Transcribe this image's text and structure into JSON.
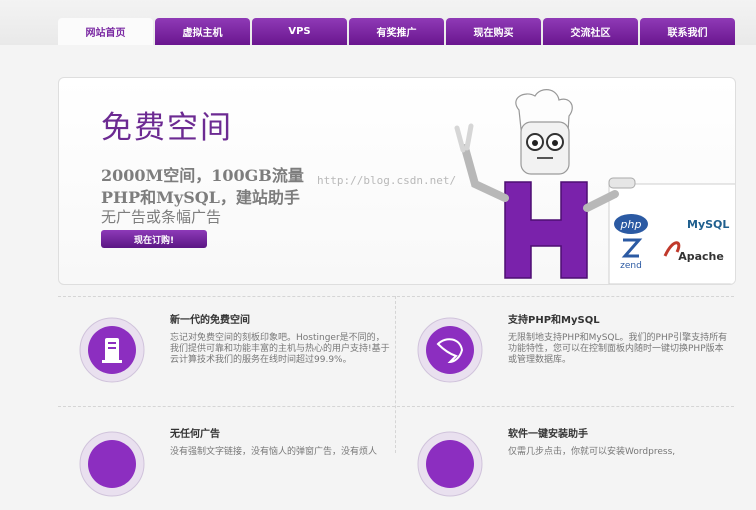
{
  "nav": {
    "tabs": [
      {
        "label": "网站首页",
        "active": true
      },
      {
        "label": "虚拟主机",
        "active": false
      },
      {
        "label": "VPS",
        "active": false
      },
      {
        "label": "有奖推广",
        "active": false
      },
      {
        "label": "现在购买",
        "active": false
      },
      {
        "label": "交流社区",
        "active": false
      },
      {
        "label": "联系我们",
        "active": false
      }
    ]
  },
  "banner": {
    "title": "免费空间",
    "line1": "2000M空间，100GB流量",
    "line2": "PHP和MySQL，建站助手",
    "line3": "无广告或条幅广告",
    "button": "现在订购!",
    "watermark": "http://blog.csdn.net/",
    "logos": {
      "php": "php",
      "mysql": "MySQL",
      "zend": "zend",
      "apache": "Apache"
    }
  },
  "features": [
    {
      "title": "新一代的免费空间",
      "desc": "忘记对免费空间的刻板印象吧。Hostinger是不同的，我们提供可靠和功能丰富的主机与热心的用户支持!基于云计算技术我们的服务在线时间超过99.9%。",
      "icon": "server-icon"
    },
    {
      "title": "支持PHP和MySQL",
      "desc": "无限制地支持PHP和MySQL。我们的PHP引擎支持所有功能特性，您可以在控制面板内随时一键切换PHP版本或管理数据库。",
      "icon": "dolphin-icon"
    },
    {
      "title": "无任何广告",
      "desc": "没有强制文字链接，没有恼人的弹窗广告，没有烦人",
      "icon": "no-ads-icon"
    },
    {
      "title": "软件一键安装助手",
      "desc": "仅需几步点击，你就可以安装Wordpress,",
      "icon": "installer-icon"
    }
  ],
  "colors": {
    "brand": "#6c1a94",
    "nav_tab": "#7a25a3",
    "text_gray": "#7d7d7d"
  }
}
